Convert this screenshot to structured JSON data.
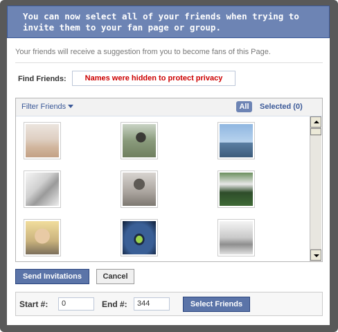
{
  "header": {
    "line1": "You can now select all of your friends when trying to",
    "line2": "invite them to your fan page or group."
  },
  "dialog": {
    "subtitle": "Your friends will receive a suggestion from you to become fans of this Page."
  },
  "find": {
    "label": "Find Friends:",
    "value": "Names were hidden to protect privacy"
  },
  "friends_panel": {
    "filter_label": "Filter Friends",
    "all_label": "All",
    "selected_label": "Selected (0)",
    "thumbnails": [
      {
        "icon": "friend-photo"
      },
      {
        "icon": "friend-photo"
      },
      {
        "icon": "friend-photo"
      },
      {
        "icon": "friend-photo"
      },
      {
        "icon": "friend-photo"
      },
      {
        "icon": "friend-photo"
      },
      {
        "icon": "friend-photo"
      },
      {
        "icon": "friend-photo"
      },
      {
        "icon": "friend-photo"
      }
    ]
  },
  "actions": {
    "send_label": "Send Invitations",
    "cancel_label": "Cancel"
  },
  "range": {
    "start_label": "Start #:",
    "start_value": "0",
    "end_label": "End #:",
    "end_value": "344",
    "select_label": "Select Friends"
  },
  "colors": {
    "header_bg": "#6d84b4",
    "link": "#3b5998",
    "button_bg": "#5b74a8",
    "warning_text": "#cc0000"
  }
}
